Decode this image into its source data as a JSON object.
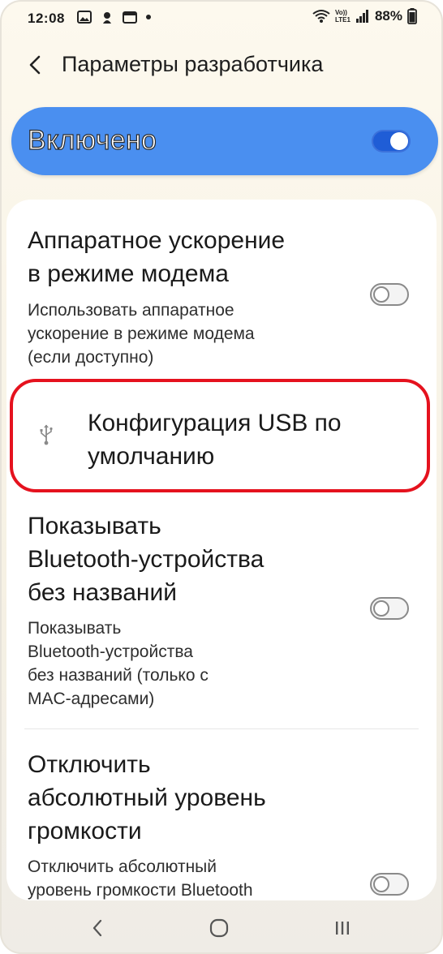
{
  "status_bar": {
    "time": "12:08",
    "battery_text": "88%",
    "network_label_top": "Vo))",
    "network_label_bottom": "LTE1"
  },
  "header": {
    "title": "Параметры разработчика"
  },
  "master_switch": {
    "label": "Включено",
    "state": "on"
  },
  "settings": [
    {
      "title_line1": "Аппаратное ускорение",
      "title_line2": "в режиме модема",
      "desc_line1": "Использовать аппаратное",
      "desc_line2": "ускорение в режиме модема",
      "desc_line3": "(если доступно)",
      "toggle": "off"
    },
    {
      "title_line1": "Конфигурация USB по",
      "title_line2": "умолчанию",
      "icon": "usb-icon",
      "highlighted": true
    },
    {
      "title_line1": "Показывать",
      "title_line2": "Bluetooth-устройства",
      "title_line3": "без названий",
      "desc_line1": "Показывать",
      "desc_line2": "Bluetooth-устройства",
      "desc_line3": "без названий (только с",
      "desc_line4": "MAC-адресами)",
      "toggle": "off"
    },
    {
      "title_line1": "Отключить",
      "title_line2": "абсолютный уровень",
      "title_line3": "громкости",
      "desc_line1": "Отключить абсолютный",
      "desc_line2": "уровень громкости Bluetooth",
      "toggle": "off"
    }
  ],
  "nav_bar": {
    "buttons": [
      "back-icon",
      "home-icon",
      "recents-icon"
    ]
  },
  "colors": {
    "accent": "#4a8ff0",
    "toggle_on": "#1f5dd6",
    "highlight": "#e5121e"
  }
}
